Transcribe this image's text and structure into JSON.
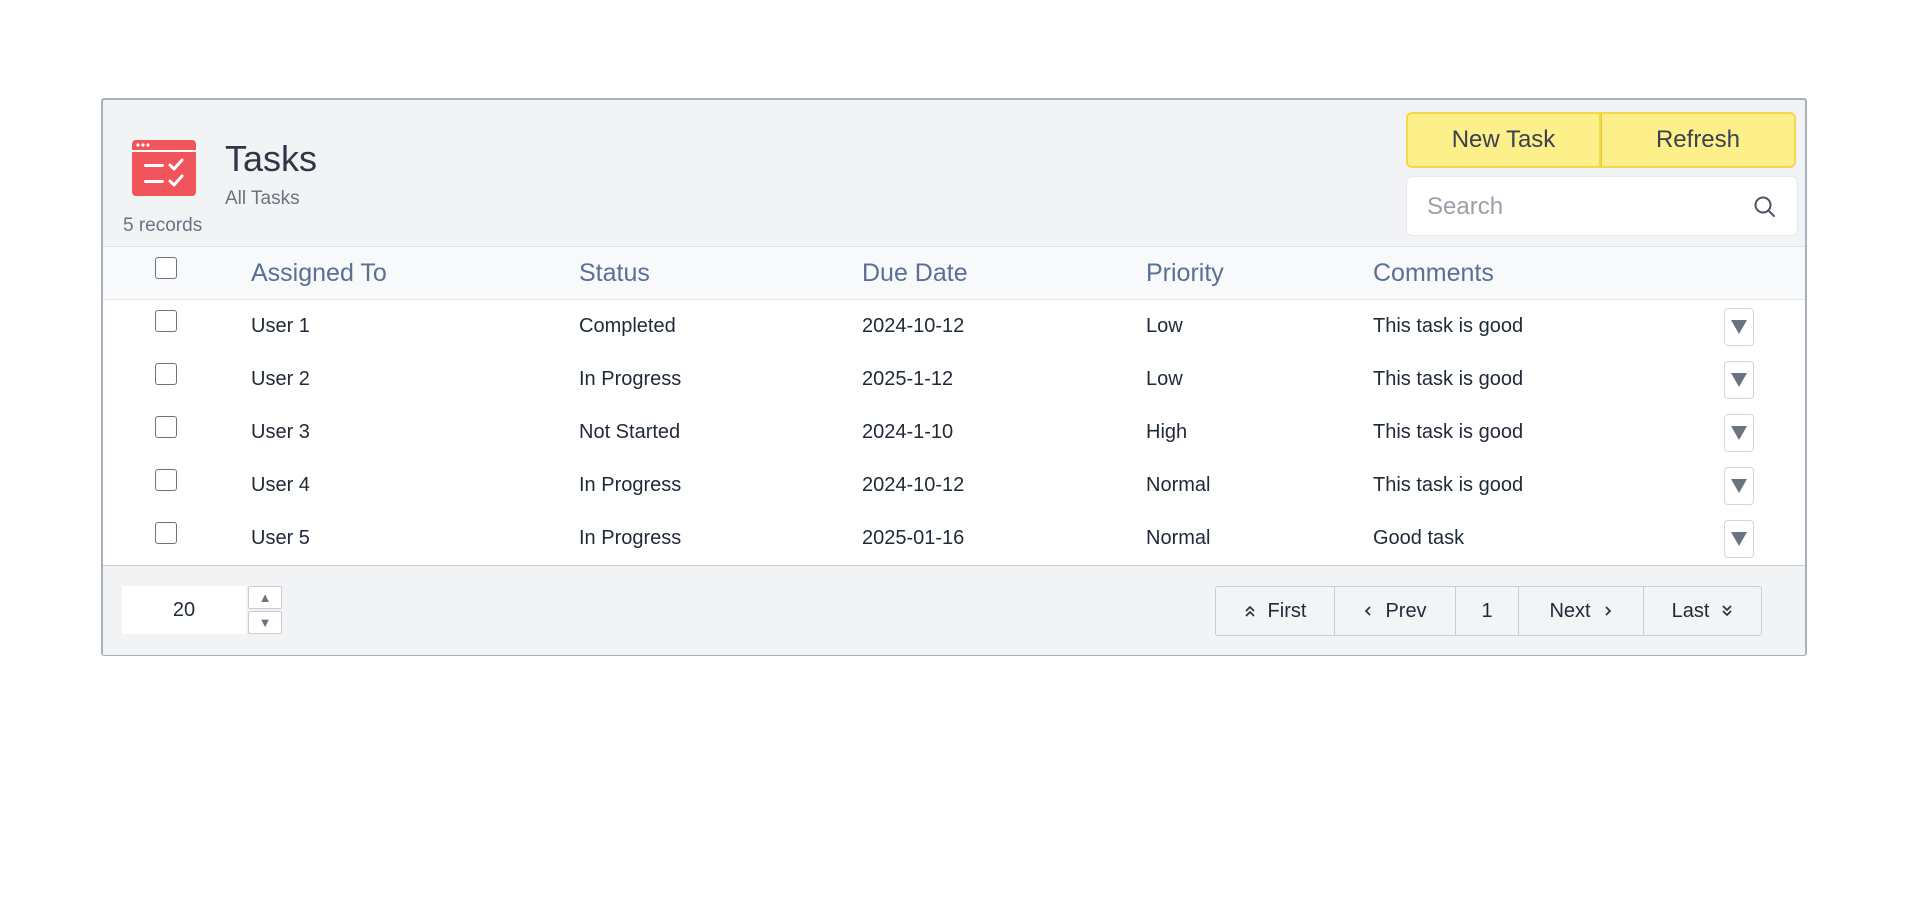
{
  "header": {
    "title": "Tasks",
    "subtitle": "All Tasks",
    "records": "5 records",
    "icon": "task-list-icon",
    "accent_color": "#f2545b"
  },
  "toolbar": {
    "new_task_label": "New Task",
    "refresh_label": "Refresh",
    "button_color": "#fdef8a"
  },
  "search": {
    "placeholder": "Search",
    "value": "",
    "icon": "search-icon"
  },
  "table": {
    "columns": [
      "Assigned To",
      "Status",
      "Due Date",
      "Priority",
      "Comments"
    ],
    "rows": [
      {
        "assigned": "User 1",
        "status": "Completed",
        "due": "2024-10-12",
        "priority": "Low",
        "comments": "This task is good"
      },
      {
        "assigned": "User 2",
        "status": "In Progress",
        "due": "2025-1-12",
        "priority": "Low",
        "comments": "This task is good"
      },
      {
        "assigned": "User 3",
        "status": "Not Started",
        "due": "2024-1-10",
        "priority": "High",
        "comments": "This task is good"
      },
      {
        "assigned": "User 4",
        "status": "In Progress",
        "due": "2024-10-12",
        "priority": "Normal",
        "comments": "This task is good"
      },
      {
        "assigned": "User 5",
        "status": "In Progress",
        "due": "2025-01-16",
        "priority": "Normal",
        "comments": "Good task"
      }
    ]
  },
  "pagination": {
    "page_size": "20",
    "first_label": "First",
    "prev_label": "Prev",
    "current_page": "1",
    "next_label": "Next",
    "last_label": "Last"
  }
}
